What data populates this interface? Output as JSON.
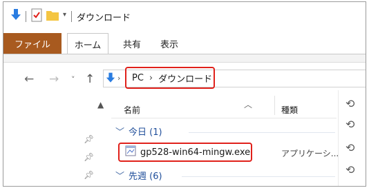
{
  "quick_access": {
    "title": "ダウンロード"
  },
  "ribbon": {
    "tabs": [
      "ファイル",
      "ホーム",
      "共有",
      "表示"
    ]
  },
  "address": {
    "crumbs": [
      "PC",
      "ダウンロード"
    ]
  },
  "columns": {
    "name": "名前",
    "type": "種類"
  },
  "groups": {
    "today": "今日 (1)",
    "last_week": "先週 (6)"
  },
  "file": {
    "name": "gp528-win64-mingw.exe",
    "type": "アプリケーシ..."
  },
  "colors": {
    "highlight": "#e0201a",
    "file_tab": "#a85a1f",
    "download_arrow": "#2a7de1"
  }
}
